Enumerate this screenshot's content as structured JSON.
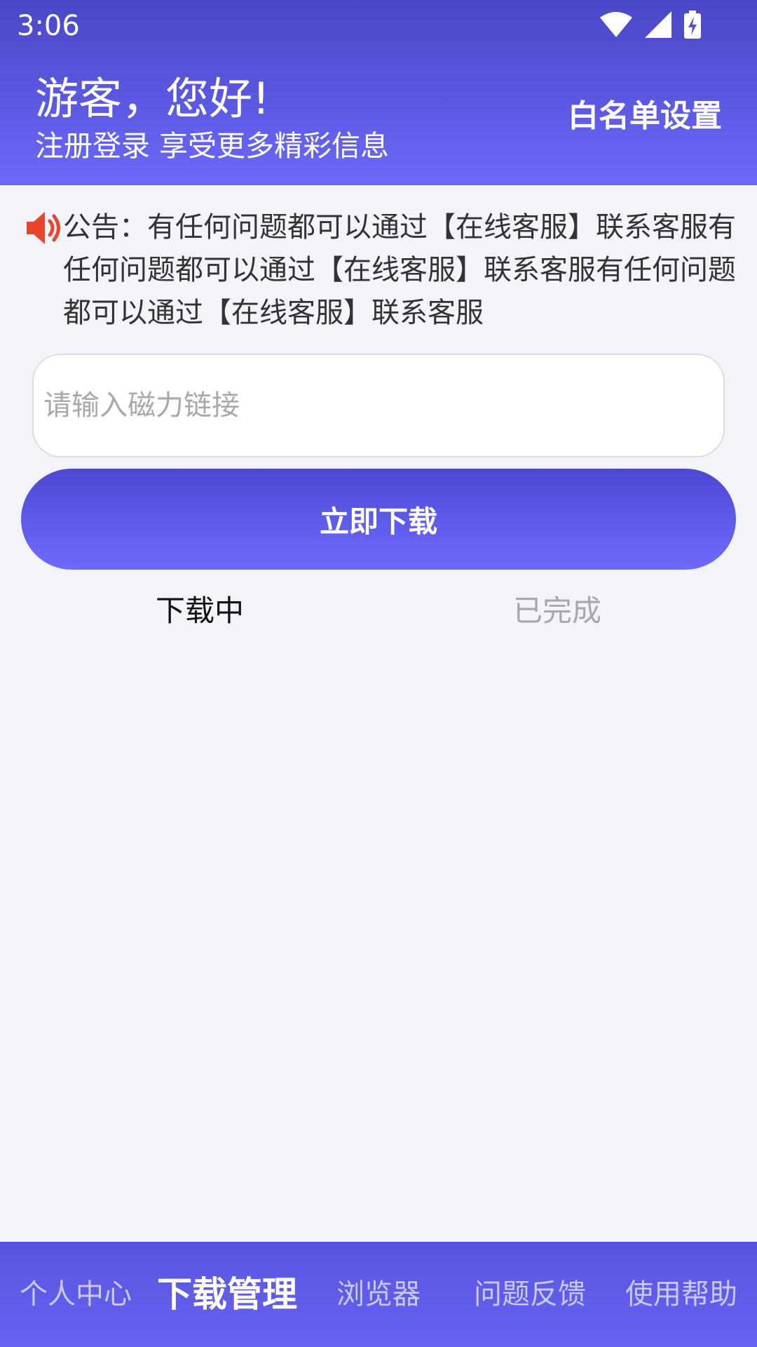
{
  "status_bar": {
    "time": "3:06",
    "icons": [
      "wifi-icon",
      "signal-icon",
      "battery-charging-icon"
    ]
  },
  "header": {
    "greeting": "游客，您好!",
    "subtitle": "注册登录 享受更多精彩信息",
    "whitelist_label": "白名单设置"
  },
  "notice": {
    "icon": "speaker-icon",
    "text": "公告：有任何问题都可以通过【在线客服】联系客服有任何问题都可以通过【在线客服】联系客服有任何问题都可以通过【在线客服】联系客服"
  },
  "magnet": {
    "placeholder": "请输入磁力链接",
    "value": ""
  },
  "download_button": {
    "label": "立即下载"
  },
  "tabs": [
    {
      "label": "下载中",
      "active": true
    },
    {
      "label": "已完成",
      "active": false
    }
  ],
  "bottom_nav": [
    {
      "label": "个人中心",
      "active": false
    },
    {
      "label": "下载管理",
      "active": true
    },
    {
      "label": "浏览器",
      "active": false
    },
    {
      "label": "问题反馈",
      "active": false
    },
    {
      "label": "使用帮助",
      "active": false
    }
  ],
  "colors": {
    "primary": "#5b59e2",
    "primary_light": "#6c69fb",
    "background": "#f3f4f9",
    "speaker": "#e8452d"
  }
}
